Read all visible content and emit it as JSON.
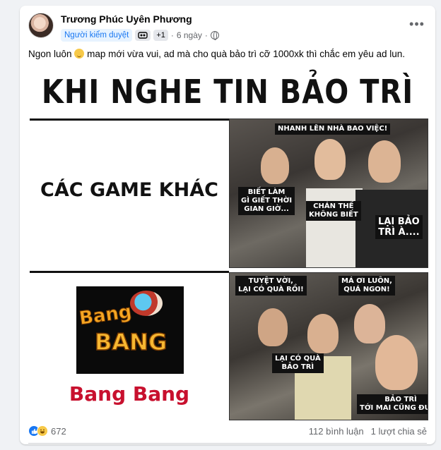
{
  "post": {
    "author": "Trương Phúc Uyên Phương",
    "badge": "Người kiểm duyệt",
    "extra_badges": "+1",
    "time": "6 ngày",
    "separator": "·",
    "text": "Ngon luôn",
    "text_after_emoji": " map mới vừa vui, ad mà cho quà bảo trì cỡ 1000xk thì chắc em yêu ad lun."
  },
  "meme": {
    "title": "KHI NGHE TIN BẢO TRÌ",
    "left_top_label": "CÁC GAME KHÁC",
    "game_logo_line1": "Bang",
    "game_logo_line2": "BANG",
    "game_name": "Bang Bang",
    "top_bubbles": [
      "NHANH LÊN\nNHÀ BAO VIỆC!",
      "BIẾT LÀM\nGÌ GIẾT THỜI\nGIAN GIỜ...",
      "CHÁN THẾ\nKHÔNG BIẾT",
      "LẠI BẢO\nTRÌ À...."
    ],
    "bottom_bubbles": [
      "TUYỆT VỜI,\nLẠI CÓ QUÀ RỒI!",
      "MÁ ƠI LUÔN,\nQUÁ NGON!",
      "LẠI CÓ QUÀ\nBẢO TRÌ",
      "BẢO TRÌ\nTỚI MAI CŨNG ĐƯỢC"
    ]
  },
  "footer": {
    "reaction_count": "672",
    "comments": "112 bình luận",
    "shares": "1 lượt chia sẻ"
  },
  "icons": {
    "like": "like-icon",
    "haha": "haha-icon",
    "more": "more-options-icon",
    "globe": "globe-icon"
  },
  "colors": {
    "accent": "#1877f2",
    "game_name": "#c8102e",
    "logo_gold": "#f5a623"
  }
}
